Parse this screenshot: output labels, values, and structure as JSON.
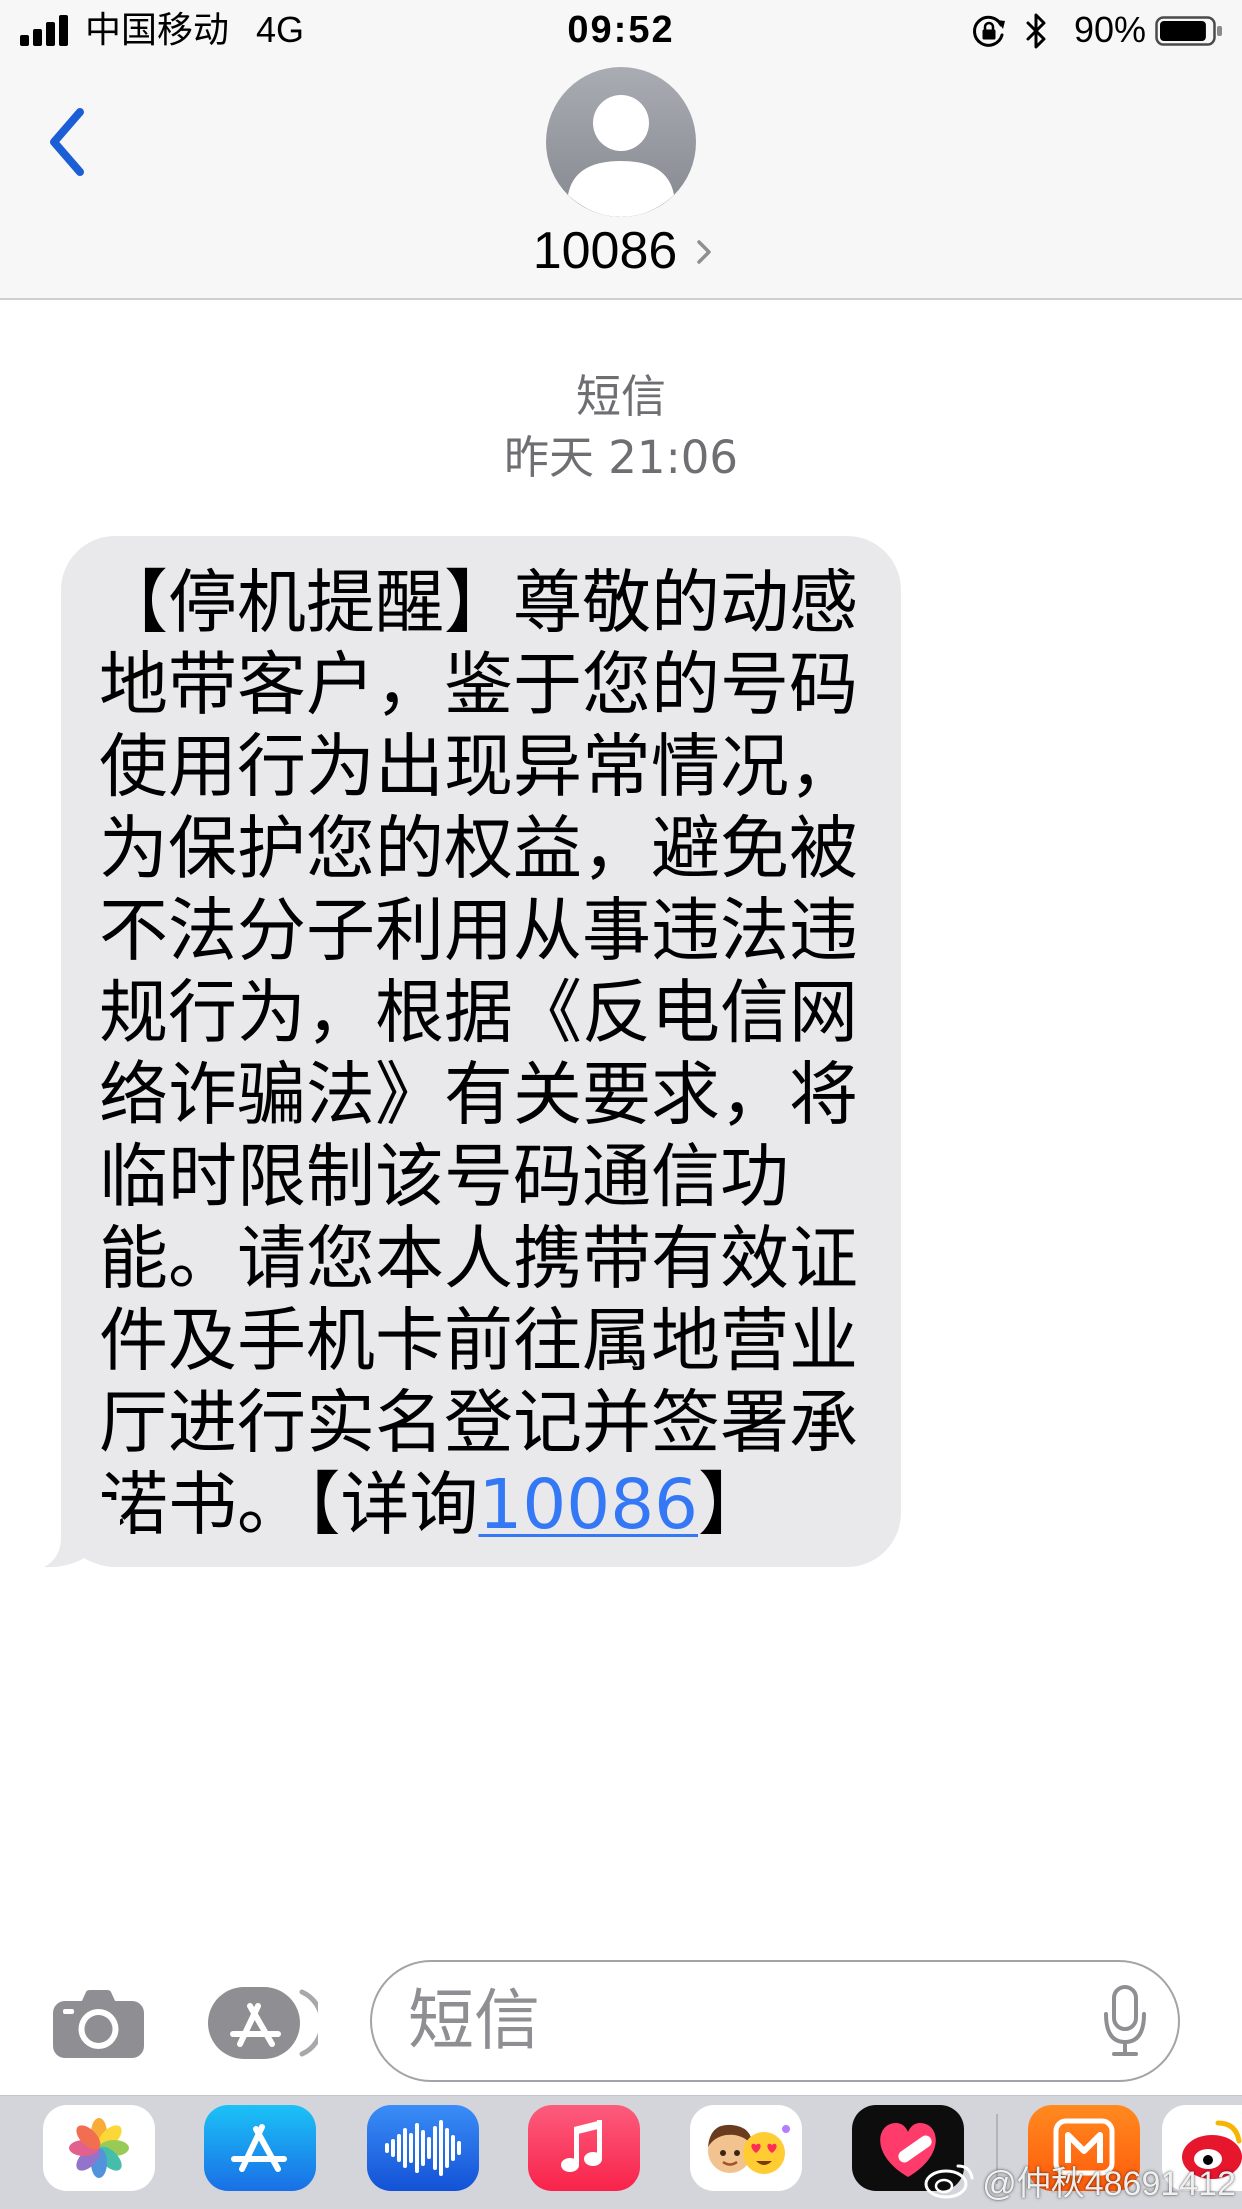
{
  "status_bar": {
    "signal_icon": "signal-bars-icon",
    "carrier": "中国移动",
    "network": "4G",
    "time": "09:52",
    "rotation_lock_icon": "rotation-lock-icon",
    "bluetooth_icon": "bluetooth-icon",
    "battery_label": "90%",
    "battery_level": 0.9,
    "battery_icon": "battery-icon"
  },
  "header": {
    "back_icon": "chevron-left-icon",
    "avatar_icon": "person-avatar-icon",
    "contact_name": "10086",
    "details_icon": "chevron-right-icon"
  },
  "thread": {
    "service_label": "短信",
    "timestamp": "昨天 21:06",
    "message": {
      "lines": [
        "【停机提醒】尊敬的动感",
        "地带客户，鉴于您的号码",
        "使用行为出现异常情况，",
        "为保护您的权益，避免被",
        "不法分子利用从事违法违",
        "规行为，根据《反电信网",
        "络诈骗法》有关要求，将",
        "临时限制该号码通信功",
        "能。请您本人携带有效证",
        "件及手机卡前往属地营业",
        "厅进行实名登记并签署承"
      ],
      "last_line_prefix": "诺书。【详询",
      "link_text": "10086",
      "last_line_suffix": "】"
    }
  },
  "compose": {
    "camera_icon": "camera-icon",
    "apps_icon": "app-store-icon",
    "placeholder": "短信",
    "mic_icon": "microphone-icon"
  },
  "app_drawer": {
    "apps": [
      {
        "icon": "photos-app-icon"
      },
      {
        "icon": "app-store-app-icon"
      },
      {
        "icon": "audio-waveform-app-icon"
      },
      {
        "icon": "music-app-icon"
      },
      {
        "icon": "memoji-stickers-app-icon"
      },
      {
        "icon": "heart-app-icon"
      },
      {
        "icon": "mango-tv-app-icon"
      },
      {
        "icon": "weibo-app-icon"
      }
    ]
  },
  "watermark": {
    "logo_icon": "weibo-logo-icon",
    "text": "@仲秋48691412"
  },
  "colors": {
    "accent": "#1c5ed6",
    "link": "#3478f6",
    "bubble_incoming": "#e9e9eb",
    "header_background": "#f7f7f7",
    "secondary_text": "#6e6e73",
    "icon_gray": "#8e8e93"
  }
}
